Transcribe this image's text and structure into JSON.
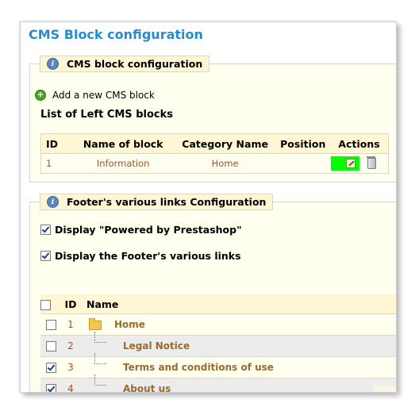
{
  "page": {
    "title": "CMS Block configuration"
  },
  "cms_block": {
    "legend": "CMS block configuration",
    "add_label": "Add a new CMS block",
    "list_title": "List of Left CMS blocks",
    "columns": [
      "ID",
      "Name of block",
      "Category Name",
      "Position",
      "Actions"
    ],
    "rows": [
      {
        "id": "1",
        "name": "Information",
        "category": "Home",
        "position": ""
      }
    ]
  },
  "footer_links": {
    "legend": "Footer's various links Configuration",
    "option_powered": {
      "label": "Display \"Powered by Prestashop\"",
      "checked": true
    },
    "option_footer": {
      "label": "Display the Footer's various links",
      "checked": true
    },
    "columns": [
      "ID",
      "Name"
    ],
    "rows": [
      {
        "id": "1",
        "name": "Home",
        "checked": false,
        "icon": "folder-icon"
      },
      {
        "id": "2",
        "name": "Legal Notice",
        "checked": false,
        "icon": "tree-branch"
      },
      {
        "id": "3",
        "name": "Terms and conditions of use",
        "checked": true,
        "icon": "tree-branch"
      },
      {
        "id": "4",
        "name": "About us",
        "checked": true,
        "icon": "tree-branch"
      }
    ]
  },
  "colors": {
    "title": "#268ccd",
    "fieldset_bg": "#fffff0",
    "header_bg": "#fff6d3",
    "link_text": "#a0522d",
    "edit_highlight": "#00ff00"
  }
}
